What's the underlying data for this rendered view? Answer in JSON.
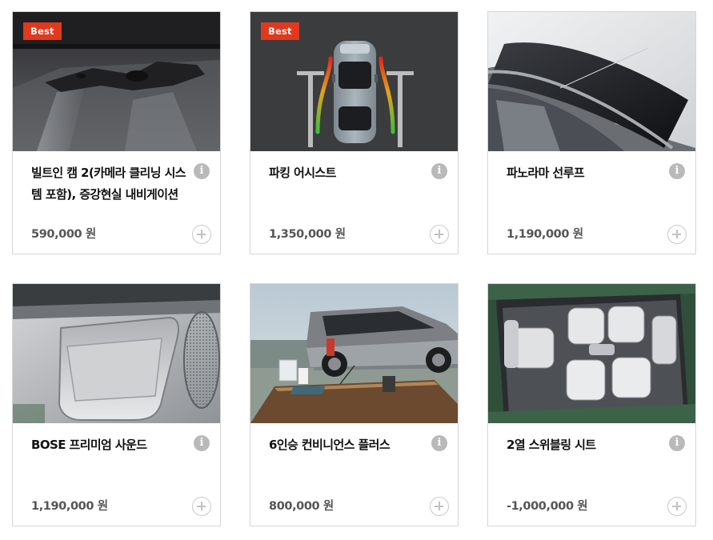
{
  "options": [
    {
      "id": "builtin-cam",
      "badge": "Best",
      "title": "빌트인 캠 2(카메라 클리닝 시스템 포함), 증강현실 내비게이션",
      "price": "590,000 원",
      "image": "builtin-cam-photo"
    },
    {
      "id": "parking-assist",
      "badge": "Best",
      "title": "파킹 어시스트",
      "price": "1,350,000 원",
      "image": "parking-assist-illustration"
    },
    {
      "id": "panorama-sunroof",
      "badge": "",
      "title": "파노라마 선루프",
      "price": "1,190,000 원",
      "image": "panorama-sunroof-photo"
    },
    {
      "id": "bose-sound",
      "badge": "",
      "title": "BOSE 프리미엄 사운드",
      "price": "1,190,000 원",
      "image": "bose-speaker-photo"
    },
    {
      "id": "convenience-plus-6",
      "badge": "",
      "title": "6인승 컨비니언스 플러스",
      "price": "800,000 원",
      "image": "car-camping-photo"
    },
    {
      "id": "swivel-seat",
      "badge": "",
      "title": "2열 스위블링 시트",
      "price": "-1,000,000 원",
      "image": "swivel-seat-photo"
    }
  ],
  "icons": {
    "info": "info-icon",
    "add": "plus-circle-icon",
    "info_glyph": "i"
  },
  "colors": {
    "badge": "#e0391e",
    "price_text": "#555555",
    "border": "#d6d6d6",
    "info_icon": "#b9b9b9"
  }
}
